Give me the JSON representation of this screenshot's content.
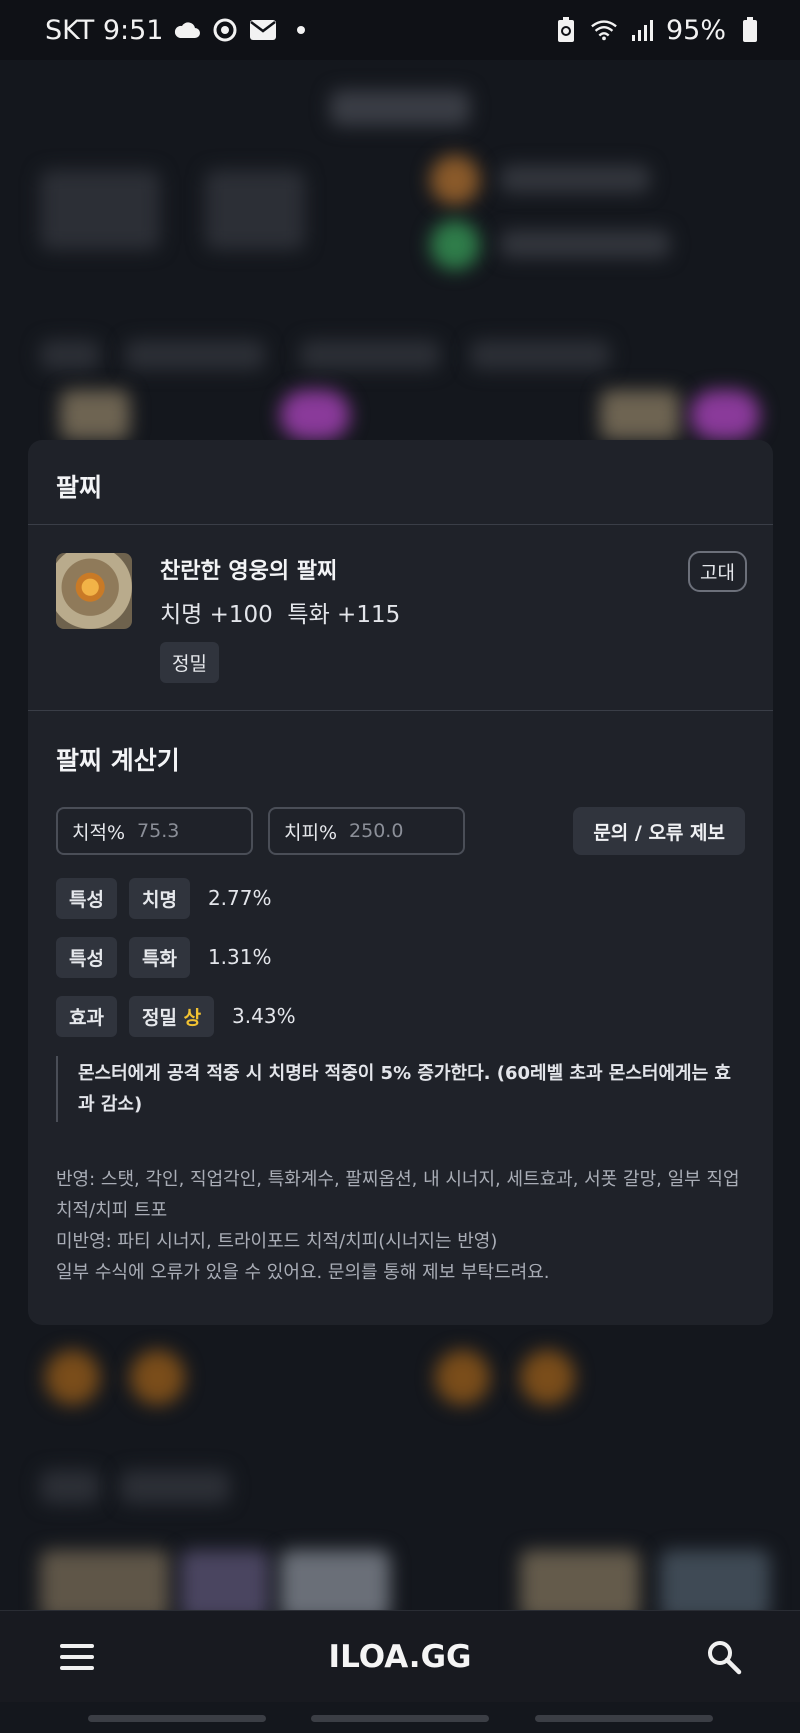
{
  "status_bar": {
    "carrier_time": "SKT 9:51",
    "battery": "95%"
  },
  "modal": {
    "header": "팔찌",
    "item": {
      "name": "찬란한 영웅의 팔찌",
      "stats": "치명 +100  특화 +115",
      "tag": "정밀",
      "grade": "고대"
    },
    "calculator": {
      "title": "팔찌 계산기",
      "crit_rate": {
        "label": "치적%",
        "value": "75.3"
      },
      "crit_dmg": {
        "label": "치피%",
        "value": "250.0"
      },
      "report_button": "문의 / 오류 제보",
      "results": [
        {
          "type": "특성",
          "name": "치명",
          "grade": "",
          "value": "2.77%"
        },
        {
          "type": "특성",
          "name": "특화",
          "grade": "",
          "value": "1.31%"
        },
        {
          "type": "효과",
          "name": "정밀",
          "grade": "상",
          "value": "3.43%"
        }
      ],
      "effect_description": "몬스터에게 공격 적중 시 치명타 적중이 5% 증가한다. (60레벨 초과 몬스터에게는 효과 감소)",
      "notes": {
        "reflected": "반영: 스탯, 각인, 직업각인, 특화계수, 팔찌옵션, 내 시너지, 세트효과, 서폿 갈망, 일부 직업 치적/치피 트포",
        "not_reflected": "미반영: 파티 시너지, 트라이포드 치적/치피(시너지는 반영)",
        "disclaimer": "일부 수식에 오류가 있을 수 있어요. 문의를 통해 제보 부탁드려요."
      }
    }
  },
  "bottom_bar": {
    "logo": "ILOA.GG"
  }
}
